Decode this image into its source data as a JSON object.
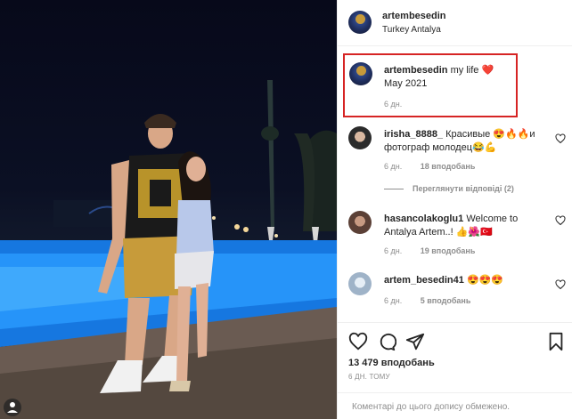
{
  "post": {
    "username": "artembesedin",
    "location": "Turkey Antalya",
    "caption_user": "artembesedin",
    "caption_text": "my life",
    "caption_heart": "❤️",
    "caption_line2": "May 2021",
    "caption_time": "6 дн."
  },
  "comments": [
    {
      "user": "irisha_8888_",
      "text": "Красивые 😍🔥🔥и фотограф молодец😂💪",
      "time": "6 дн.",
      "likes": "18 вподобань",
      "avatar_color": "#2b2b2b"
    },
    {
      "user": "hasancolakoglu1",
      "text": "Welcome to Antalya Artem..! 👍🌺🇹🇷",
      "time": "6 дн.",
      "likes": "19 вподобань",
      "avatar_color": "#7a5a4a"
    },
    {
      "user": "artem_besedin41",
      "text": "😍😍😍",
      "time": "6 дн.",
      "likes": "5 вподобань",
      "avatar_color": "#9fb3c8"
    }
  ],
  "view_replies": "Переглянути відповіді (2)",
  "likes_total": "13 479 вподобань",
  "time_ago": "6 ДН. ТОМУ",
  "comments_closed": "Коментарі до цього допису обмежено.",
  "colors": {
    "highlight_border": "#d62424",
    "heart": "#e0245e",
    "muted_text": "#8e8e8e"
  }
}
